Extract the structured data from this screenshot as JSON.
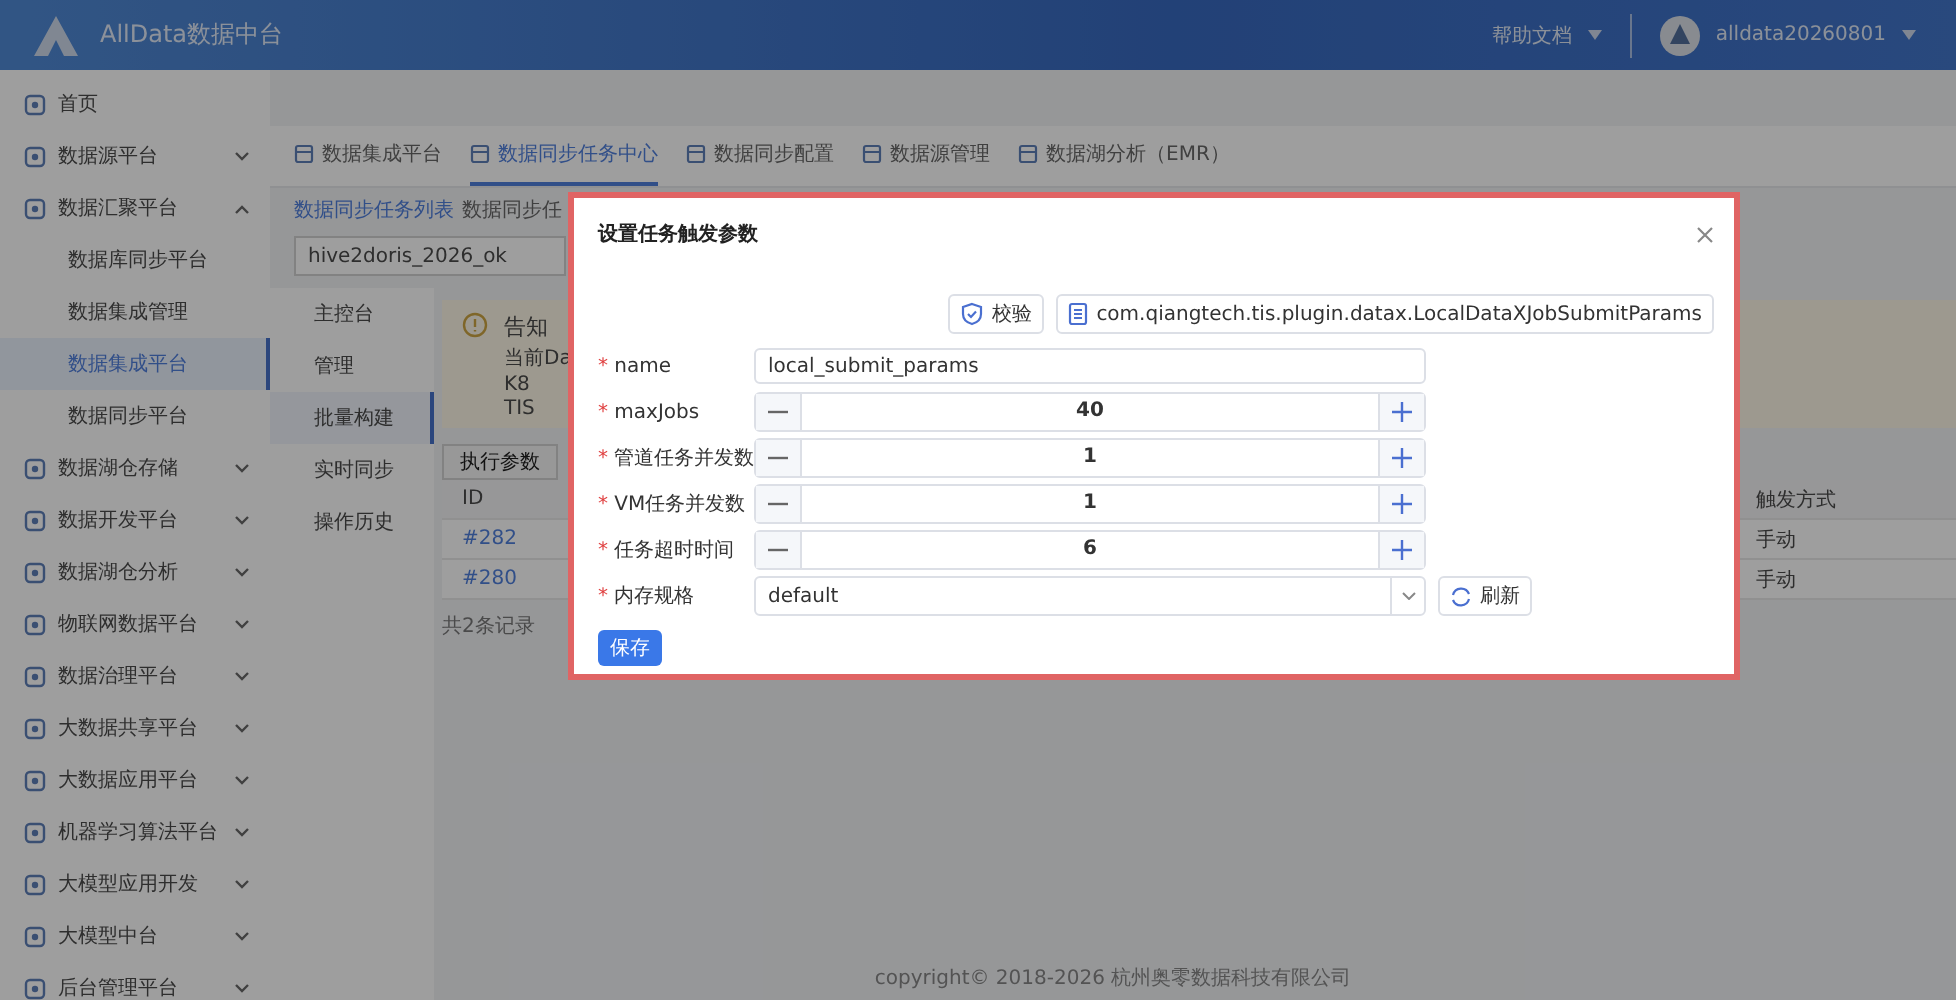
{
  "header": {
    "logo_text": "AllData数据中台",
    "help": "帮助文档",
    "user": "alldata20260801"
  },
  "sidebar": {
    "items": [
      {
        "label": "首页",
        "kind": "item",
        "selected": false
      },
      {
        "label": "数据源平台",
        "kind": "group",
        "expanded": false
      },
      {
        "label": "数据汇聚平台",
        "kind": "group",
        "expanded": true,
        "children": [
          {
            "label": "数据库同步平台",
            "selected": false
          },
          {
            "label": "数据集成管理",
            "selected": false
          },
          {
            "label": "数据集成平台",
            "selected": true
          },
          {
            "label": "数据同步平台",
            "selected": false
          }
        ]
      },
      {
        "label": "数据湖仓存储",
        "kind": "group",
        "expanded": false
      },
      {
        "label": "数据开发平台",
        "kind": "group",
        "expanded": false
      },
      {
        "label": "数据湖仓分析",
        "kind": "group",
        "expanded": false
      },
      {
        "label": "物联网数据平台",
        "kind": "group",
        "expanded": false
      },
      {
        "label": "数据治理平台",
        "kind": "group",
        "expanded": false
      },
      {
        "label": "大数据共享平台",
        "kind": "group",
        "expanded": false
      },
      {
        "label": "大数据应用平台",
        "kind": "group",
        "expanded": false
      },
      {
        "label": "机器学习算法平台",
        "kind": "group",
        "expanded": false
      },
      {
        "label": "大模型应用开发",
        "kind": "group",
        "expanded": false
      },
      {
        "label": "大模型中台",
        "kind": "group",
        "expanded": false
      },
      {
        "label": "后台管理平台",
        "kind": "group",
        "expanded": false
      }
    ]
  },
  "tabs": [
    {
      "label": "数据集成平台",
      "selected": false
    },
    {
      "label": "数据同步任务中心",
      "selected": true
    },
    {
      "label": "数据同步配置",
      "selected": false
    },
    {
      "label": "数据源管理",
      "selected": false
    },
    {
      "label": "数据湖分析（EMR）",
      "selected": false
    }
  ],
  "sub_tabs": [
    {
      "label": "数据同步任务列表",
      "selected": true
    },
    {
      "label": "数据同步任",
      "selected": false
    }
  ],
  "pipeline_select": {
    "value": "hive2doris_2026_ok"
  },
  "inner_menu": [
    {
      "label": "主控台",
      "selected": false
    },
    {
      "label": "管理",
      "selected": false
    },
    {
      "label": "批量构建",
      "selected": true
    },
    {
      "label": "实时同步",
      "selected": false
    },
    {
      "label": "操作历史",
      "selected": false
    }
  ],
  "notice": {
    "title": "告知",
    "lines": [
      "当前Da",
      "K8",
      "TIS"
    ]
  },
  "params_button": "执行参数",
  "table": {
    "columns": [
      "ID",
      "触发方式"
    ],
    "rows": [
      [
        "#282",
        "手动"
      ],
      [
        "#280",
        "手动"
      ]
    ]
  },
  "pagination": "共2条记录",
  "footer": "copyright© 2018-2026 杭州奥零数据科技有限公司",
  "dialog": {
    "title": "设置任务触发参数",
    "verify_button": "校验",
    "plugin_button": "com.qiangtech.tis.plugin.datax.LocalDataXJobSubmitParams",
    "fields": [
      {
        "kind": "text",
        "required_mark": "*",
        "label": "name",
        "value": "local_submit_params"
      },
      {
        "kind": "number",
        "required_mark": "*",
        "label": "maxJobs",
        "value": "40"
      },
      {
        "kind": "number",
        "required_mark": "*",
        "label": "管道任务并发数",
        "value": "1"
      },
      {
        "kind": "number",
        "required_mark": "*",
        "label": "VM任务并发数",
        "value": "1"
      },
      {
        "kind": "number",
        "required_mark": "*",
        "label": "任务超时时间",
        "value": "6"
      },
      {
        "kind": "select",
        "required_mark": "*",
        "label": "内存规格",
        "value": "default",
        "action": "刷新"
      }
    ],
    "save_button": "保存"
  }
}
